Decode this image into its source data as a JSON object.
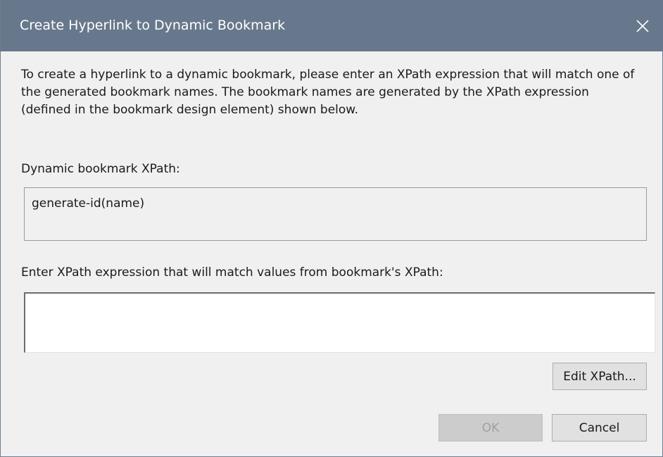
{
  "window": {
    "title": "Create Hyperlink to Dynamic Bookmark",
    "close_icon": "close-icon"
  },
  "intro": {
    "text": "To create a hyperlink to a dynamic bookmark, please enter an XPath expression that will match one of the generated bookmark names. The bookmark names are generated by the XPath expression (defined in the bookmark design element) shown below."
  },
  "dynamic_xpath": {
    "label": "Dynamic bookmark XPath:",
    "value": "generate-id(name)"
  },
  "match_xpath": {
    "label": "Enter XPath expression that will match values from bookmark's XPath:",
    "value": "",
    "placeholder": ""
  },
  "buttons": {
    "edit_xpath": "Edit XPath...",
    "ok": "OK",
    "cancel": "Cancel"
  },
  "colors": {
    "titlebar": "#68788c",
    "background": "#f0f0f0",
    "button": "#e1e1e1",
    "disabled_text": "#a0a0a0"
  }
}
